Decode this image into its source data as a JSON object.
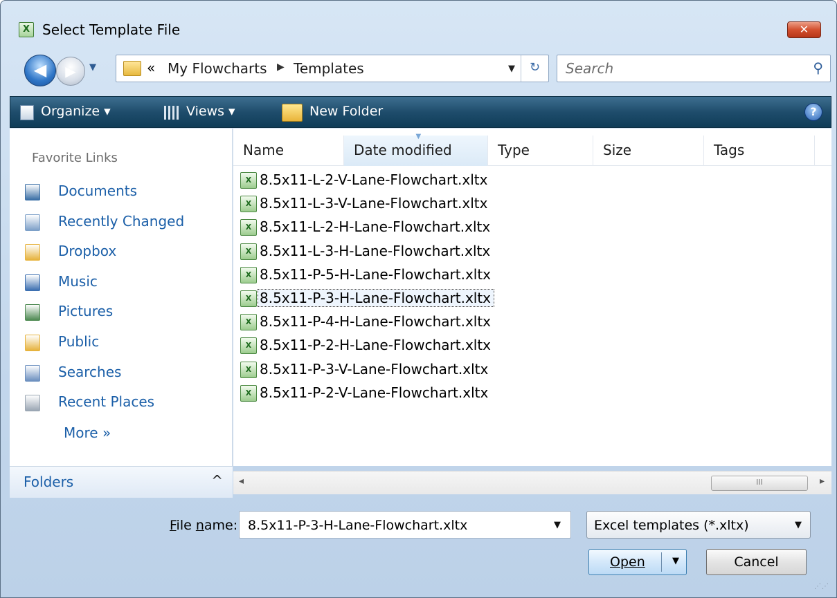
{
  "window": {
    "title": "Select Template File",
    "app_icon": "excel-icon",
    "close_glyph": "✕"
  },
  "nav": {
    "back_glyph": "◀",
    "forward_glyph": "▶",
    "history_dropdown_glyph": "▼"
  },
  "address": {
    "overflow_chevron": "«",
    "segments": [
      "My Flowcharts",
      "Templates"
    ],
    "separator_glyph": "▶",
    "dropdown_glyph": "▼",
    "refresh_glyph": "↻"
  },
  "search": {
    "placeholder": "Search",
    "icon": "search-icon"
  },
  "command_bar": {
    "organize": "Organize ▾",
    "views": "Views ▾",
    "new_folder": "New Folder",
    "help_glyph": "?"
  },
  "favorites": {
    "header": "Favorite Links",
    "items": [
      {
        "label": "Documents",
        "icon": "documents-icon",
        "color": "#3b6fa6"
      },
      {
        "label": "Recently Changed",
        "icon": "recently-changed-icon",
        "color": "#7da0c8"
      },
      {
        "label": "Dropbox",
        "icon": "dropbox-icon",
        "color": "#e6b23c"
      },
      {
        "label": "Music",
        "icon": "music-icon",
        "color": "#3c6fb0"
      },
      {
        "label": "Pictures",
        "icon": "pictures-icon",
        "color": "#4e8a52"
      },
      {
        "label": "Public",
        "icon": "public-folder-icon",
        "color": "#e6b23c"
      },
      {
        "label": "Searches",
        "icon": "searches-icon",
        "color": "#6b8fbf"
      },
      {
        "label": "Recent Places",
        "icon": "recent-places-icon",
        "color": "#9aa6b3"
      }
    ],
    "more": "More »"
  },
  "folders": {
    "label": "Folders",
    "chevron": "^"
  },
  "columns": [
    "Name",
    "Date modified",
    "Type",
    "Size",
    "Tags"
  ],
  "files": [
    "8.5x11-L-2-V-Lane-Flowchart.xltx",
    "8.5x11-L-3-V-Lane-Flowchart.xltx",
    "8.5x11-L-2-H-Lane-Flowchart.xltx",
    "8.5x11-L-3-H-Lane-Flowchart.xltx",
    "8.5x11-P-5-H-Lane-Flowchart.xltx",
    "8.5x11-P-3-H-Lane-Flowchart.xltx",
    "8.5x11-P-4-H-Lane-Flowchart.xltx",
    "8.5x11-P-2-H-Lane-Flowchart.xltx",
    "8.5x11-P-3-V-Lane-Flowchart.xltx",
    "8.5x11-P-2-V-Lane-Flowchart.xltx"
  ],
  "selected_file_index": 5,
  "file_icon_glyph": "X",
  "hscroll": {
    "left_glyph": "◂",
    "right_glyph": "▸",
    "thumb_grip": "III"
  },
  "bottom": {
    "file_name_label": "File name:",
    "file_name_value": "8.5x11-P-3-H-Lane-Flowchart.xltx",
    "file_type_value": "Excel templates (*.xltx)",
    "open_label": "Open",
    "cancel_label": "Cancel",
    "dropdown_glyph": "▼"
  }
}
